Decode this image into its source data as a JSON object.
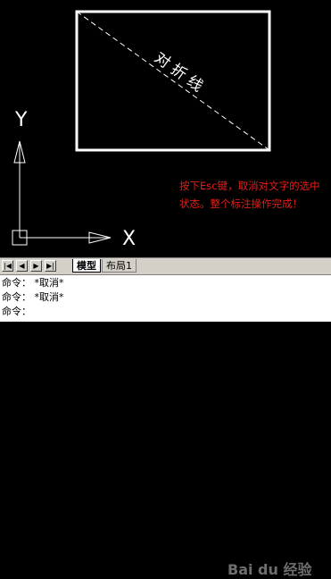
{
  "drawing": {
    "annotation_text": "对 折 线",
    "y_axis_label": "Y",
    "x_axis_label": "X",
    "instruction_line1": "按下Esc键，取消对文字的选中",
    "instruction_line2": "状态。整个标注操作完成！"
  },
  "tabs": {
    "model": "模型",
    "layout1": "布局1"
  },
  "nav_buttons": [
    "|◀",
    "◀",
    "▶",
    "▶|"
  ],
  "command_lines": [
    "命令： *取消*",
    "命令： *取消*",
    "命令："
  ],
  "watermark": "Bai du 经验",
  "colors": {
    "canvas": "#000000",
    "drawing": "#ffffff",
    "instruction": "#e0201a",
    "command_bg": "#ffffff"
  }
}
